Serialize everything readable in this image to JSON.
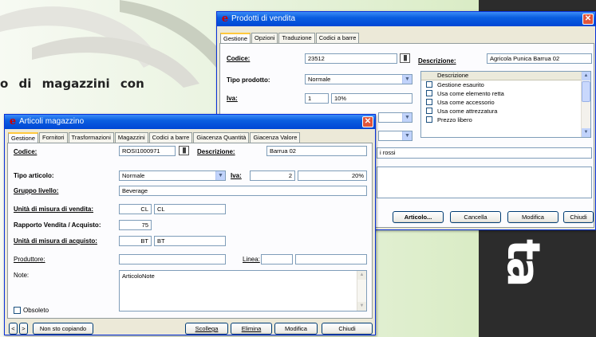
{
  "background": {
    "heading": "o di magazzini con"
  },
  "prodotti_window": {
    "title": "Prodotti di vendita",
    "tabs": [
      "Gestione",
      "Opzioni",
      "Traduzione",
      "Codici a barre"
    ],
    "codice_label": "Codice:",
    "codice_value": "23512",
    "descrizione_label": "Descrizione:",
    "descrizione_value": "Agricola Punica Barrua 02",
    "tipo_label": "Tipo prodotto:",
    "tipo_value": "Normale",
    "iva_label": "Iva:",
    "iva_code": "1",
    "iva_percent": "10%",
    "options_header": "Descrizione",
    "options": [
      "Gestione esaurito",
      "Usa come elemento retta",
      "Usa come accessorio",
      "Usa come attrezzatura",
      "Prezzo libero"
    ],
    "partial_text": "i rossi",
    "buttons": {
      "articolo": "Articolo...",
      "cancella": "Cancella",
      "modifica": "Modifica",
      "chiudi": "Chiudi"
    }
  },
  "articoli_window": {
    "title": "Articoli magazzino",
    "tabs": [
      "Gestione",
      "Fornitori",
      "Trasformazioni",
      "Magazzini",
      "Codici a barre",
      "Giacenza Quantità",
      "Giacenza Valore"
    ],
    "codice_label": "Codice:",
    "codice_value": "ROSI1000971",
    "descrizione_label": "Descrizione:",
    "descrizione_value": "Barrua 02",
    "tipo_label": "Tipo articolo:",
    "tipo_value": "Normale",
    "iva_label": "Iva:",
    "iva_code": "2",
    "iva_percent": "20%",
    "gruppo_label": "Gruppo livello:",
    "gruppo_value": "Beverage",
    "um_vendita_label": "Unità di misura di vendita:",
    "um_vendita_code": "CL",
    "um_vendita_desc": "CL",
    "rapporto_label": "Rapporto Vendita / Acquisto:",
    "rapporto_value": "75",
    "um_acquisto_label": "Unità di misura di acquisto:",
    "um_acquisto_code": "BT",
    "um_acquisto_desc": "BT",
    "produttore_label": "Produttore:",
    "linea_label": "Linea:",
    "note_label": "Note:",
    "note_value": "ArticoloNote",
    "obsoleto_label": "Obsoleto",
    "nav_prev": "<",
    "nav_next": ">",
    "status_button": "Non sto copiando",
    "buttons": {
      "scollega": "Scollega",
      "elimina": "Elimina",
      "modifica": "Modifica",
      "chiudi": "Chiudi"
    }
  },
  "colors": {
    "titlebar": "#0a5ee0",
    "window_bg": "#ece9d8",
    "close": "#e0553b",
    "tab_highlight": "#ffc83c"
  },
  "icons": [
    "app-logo-icon",
    "close-icon",
    "barcode-icon",
    "dropdown-arrow-icon",
    "scroll-up-icon",
    "scroll-down-icon"
  ]
}
